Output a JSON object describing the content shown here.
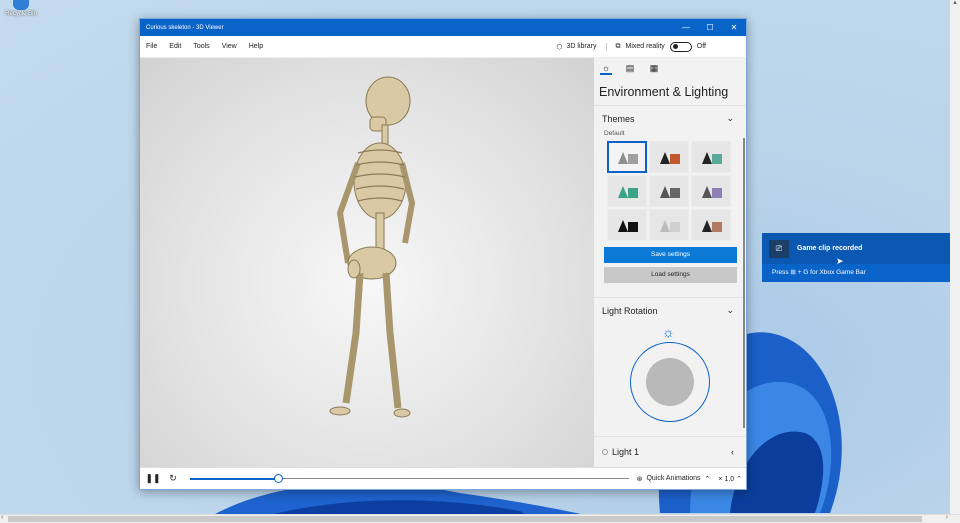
{
  "desktop": {
    "icon_label": "Recycle Bin"
  },
  "window": {
    "title": "Curious skeleton - 3D Viewer",
    "controls": {
      "minimize": "—",
      "maximize": "☐",
      "close": "✕"
    },
    "menu": [
      "File",
      "Edit",
      "Tools",
      "View",
      "Help"
    ],
    "library_label": "3D library",
    "mixed_reality_label": "Mixed reality",
    "mixed_reality_state": "Off"
  },
  "panel": {
    "title": "Environment & Lighting",
    "themes_heading": "Themes",
    "themes_selected": "Default",
    "theme_tiles": [
      {
        "cone": "#8f8f8f",
        "cube": "#a0a0a0"
      },
      {
        "cone": "#222222",
        "cube": "#c05a2e"
      },
      {
        "cone": "#222222",
        "cube": "#5aa79b"
      },
      {
        "cone": "#3aa38a",
        "cube": "#3aa38a"
      },
      {
        "cone": "#555555",
        "cube": "#666666"
      },
      {
        "cone": "#555555",
        "cube": "#8f7fb4"
      },
      {
        "cone": "#111111",
        "cube": "#111111"
      },
      {
        "cone": "#bdbdbd",
        "cube": "#cfcfcf"
      },
      {
        "cone": "#222222",
        "cube": "#b17a63"
      }
    ],
    "save_label": "Save settings",
    "load_label": "Load settings",
    "light_rotation_heading": "Light Rotation",
    "light1_label": "Light 1"
  },
  "bottombar": {
    "quick_animations_label": "Quick Animations",
    "speed_label": "× 1.0",
    "playback_progress": 0.2
  },
  "notification": {
    "title": "Game clip recorded",
    "body": "Press ⊞ + G for Xbox Game Bar"
  },
  "colors": {
    "accent": "#0a63c9"
  }
}
